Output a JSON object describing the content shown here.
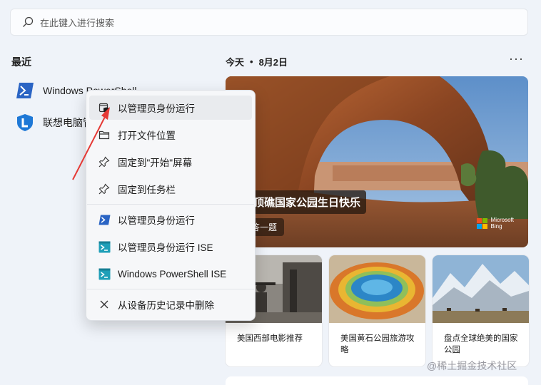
{
  "search": {
    "placeholder": "在此键入进行搜索"
  },
  "recent": {
    "title": "最近",
    "apps": [
      {
        "label": "Windows PowerShell",
        "icon": "powershell-icon"
      },
      {
        "label": "联想电脑管家",
        "icon": "lenovo-manager-icon"
      }
    ]
  },
  "feed": {
    "today": "今天",
    "dot": "•",
    "date": "8月2日",
    "more": "···",
    "hero": {
      "title": "圆顶礁国家公园生日快乐",
      "quiz": "回答一题",
      "brand_line1": "Microsoft",
      "brand_line2": "Bing"
    },
    "cards": [
      {
        "caption": "美国西部电影推荐"
      },
      {
        "caption": "美国黄石公园旅游攻略"
      },
      {
        "caption": "盘点全球绝美的国家公园"
      }
    ]
  },
  "context_menu": {
    "items": [
      {
        "label": "以管理员身份运行",
        "icon": "admin-shield-icon"
      },
      {
        "label": "打开文件位置",
        "icon": "folder-icon"
      },
      {
        "label": "固定到\"开始\"屏幕",
        "icon": "pin-icon"
      },
      {
        "label": "固定到任务栏",
        "icon": "pin-icon"
      },
      {
        "label": "以管理员身份运行",
        "icon": "powershell-icon"
      },
      {
        "label": "以管理员身份运行 ISE",
        "icon": "powershell-ise-icon"
      },
      {
        "label": "Windows PowerShell ISE",
        "icon": "powershell-ise-icon"
      },
      {
        "label": "从设备历史记录中删除",
        "icon": "close-icon"
      }
    ]
  },
  "watermark": "@稀土掘金技术社区",
  "colors": {
    "accent": "#0078d4",
    "annotation_arrow": "#e53935",
    "menu_bg": "#f6f7f9"
  }
}
